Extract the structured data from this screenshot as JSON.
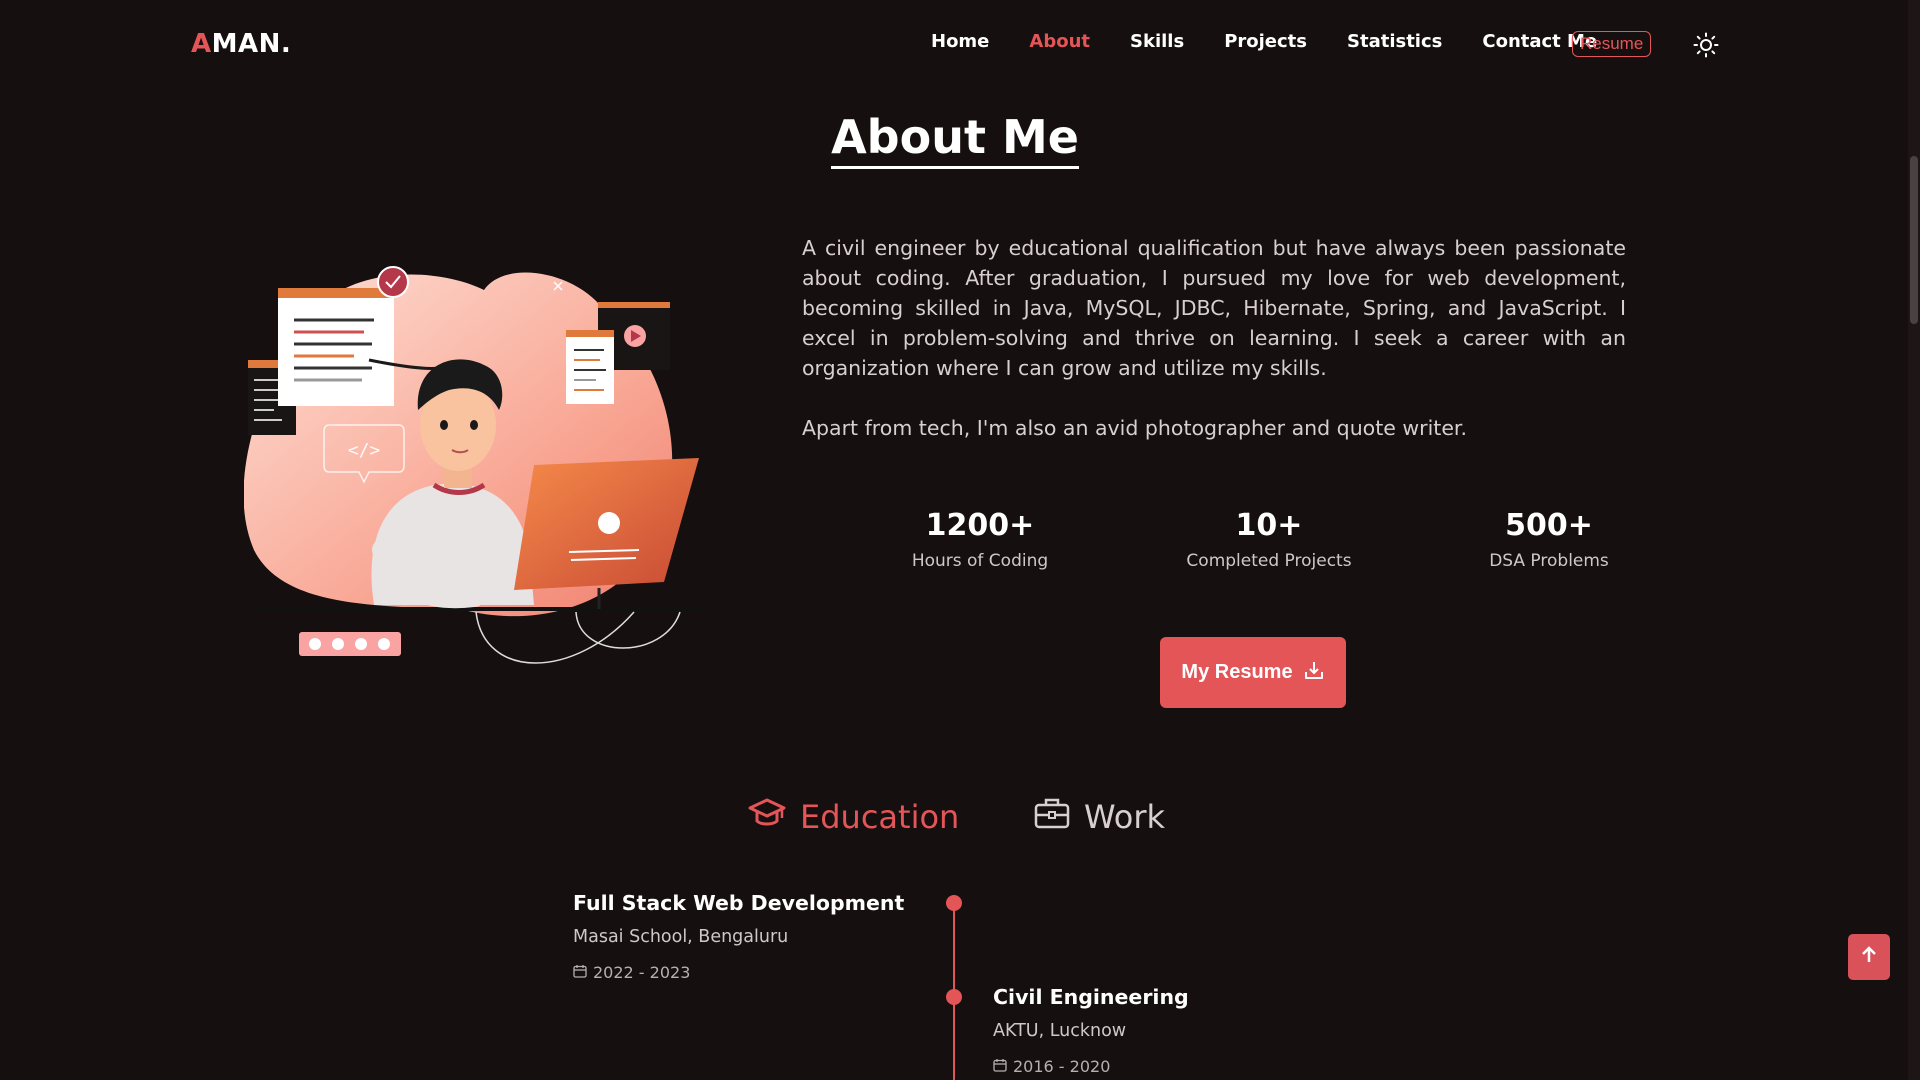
{
  "nav": {
    "logo_first": "A",
    "logo_rest": "MAN.",
    "links": [
      "Home",
      "About",
      "Skills",
      "Projects",
      "Statistics",
      "Contact Me"
    ],
    "active_link": "About",
    "resume_label": "Resume",
    "theme_icon": "sun-icon"
  },
  "about": {
    "title": "About Me",
    "paragraph1": "A civil engineer by educational qualification but have always been passionate about coding. After graduation, I pursued my love for web development, becoming skilled in Java, MySQL, JDBC, Hibernate, Spring, and JavaScript. I excel in problem-solving and thrive on learning. I seek a career with an organization where I can grow and utilize my skills.",
    "paragraph2": "Apart from tech, I'm also an avid photographer and quote writer.",
    "stats": [
      {
        "value": "1200+",
        "label": "Hours of Coding"
      },
      {
        "value": "10+",
        "label": "Completed Projects"
      },
      {
        "value": "500+",
        "label": "DSA Problems"
      }
    ],
    "resume_button_label": "My Resume",
    "resume_button_icon": "download-icon"
  },
  "qualification": {
    "tabs": [
      {
        "label": "Education",
        "icon": "graduation-cap-icon",
        "active": true
      },
      {
        "label": "Work",
        "icon": "briefcase-icon",
        "active": false
      }
    ],
    "timeline": [
      {
        "title": "Full Stack Web Development",
        "place": "Masai School, Bengaluru",
        "date": "2022 - 2023"
      },
      {
        "title": "Civil Engineering",
        "place": "AKTU, Lucknow",
        "date": "2016 - 2020"
      }
    ]
  },
  "colors": {
    "background": "#160f0f",
    "accent": "#e45558",
    "text": "#ffffff"
  }
}
